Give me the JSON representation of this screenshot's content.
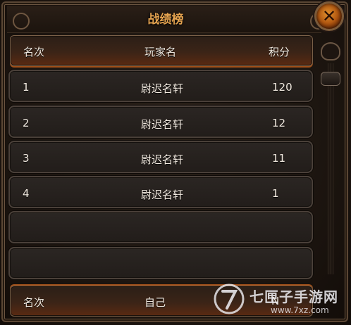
{
  "window": {
    "title": "战绩榜",
    "close_icon": "close-icon"
  },
  "table": {
    "headers": {
      "rank": "名次",
      "player": "玩家名",
      "score": "积分"
    },
    "rows": [
      {
        "rank": "1",
        "player": "尉迟名轩",
        "score": "120"
      },
      {
        "rank": "2",
        "player": "尉迟名轩",
        "score": "12"
      },
      {
        "rank": "3",
        "player": "尉迟名轩",
        "score": "11"
      },
      {
        "rank": "4",
        "player": "尉迟名轩",
        "score": "1"
      },
      {
        "rank": "",
        "player": "",
        "score": ""
      },
      {
        "rank": "",
        "player": "",
        "score": ""
      }
    ]
  },
  "footer": {
    "rank_label": "名次",
    "self_label": "自己",
    "self_rank": "N"
  },
  "watermark": {
    "brand": "七匣子手游网",
    "url": "www.7xz.com"
  },
  "colors": {
    "title": "#e3a24f",
    "close_button": "#b45a12",
    "text": "#f3ebe1"
  }
}
